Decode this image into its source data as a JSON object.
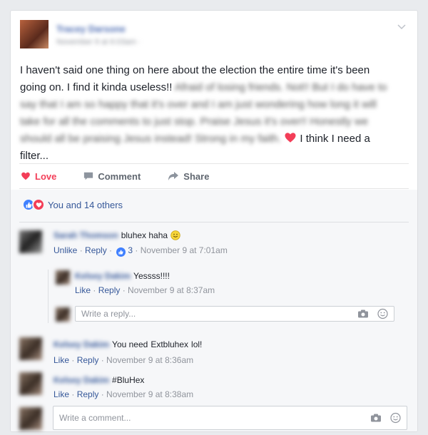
{
  "post": {
    "author": "Tracey Darsone",
    "meta": "November 9 at 6:03am · ",
    "text_visible_1": "I haven't said one thing on here about the election the entire time it's been going on. I find it kinda useless!!",
    "text_blurred": "Afraid of losing friends. Not!! But I do have to say that I am so happy that it's over and I am just wondering how long it will take for all the comments to just stop. Praise Jesus it's over!! Honestly we should all be praising Jesus instead! Strong in my faith.",
    "text_visible_2": "I think I need a filter..."
  },
  "actions": {
    "love": "Love",
    "comment": "Comment",
    "share": "Share"
  },
  "reactions": {
    "label": "You and 14 others"
  },
  "comments": [
    {
      "name": "Sarah Thomson",
      "text": "bluhex haha",
      "unlike": "Unlike",
      "reply": "Reply",
      "likes": "3",
      "time": "November 9 at 7:01am",
      "replies": [
        {
          "name": "Kelsey Dakim",
          "text": "Yessss!!!!",
          "like": "Like",
          "reply": "Reply",
          "time": "November 9 at 8:37am"
        }
      ]
    },
    {
      "name": "Kelsey Dakim",
      "text_before": "You need",
      "link": "Extbluhex",
      "text_after": "lol!",
      "like": "Like",
      "reply": "Reply",
      "time": "November 9 at 8:36am"
    },
    {
      "name": "Kelsey Dakim",
      "text": "#BluHex",
      "like": "Like",
      "reply": "Reply",
      "time": "November 9 at 8:38am"
    }
  ],
  "reply_input": {
    "placeholder": "Write a reply..."
  },
  "comment_input": {
    "placeholder": "Write a comment..."
  },
  "colors": {
    "love": "#f33e58",
    "link": "#365899",
    "like_blue": "#4080ff",
    "text": "#1d2129",
    "muted": "#90949c"
  }
}
